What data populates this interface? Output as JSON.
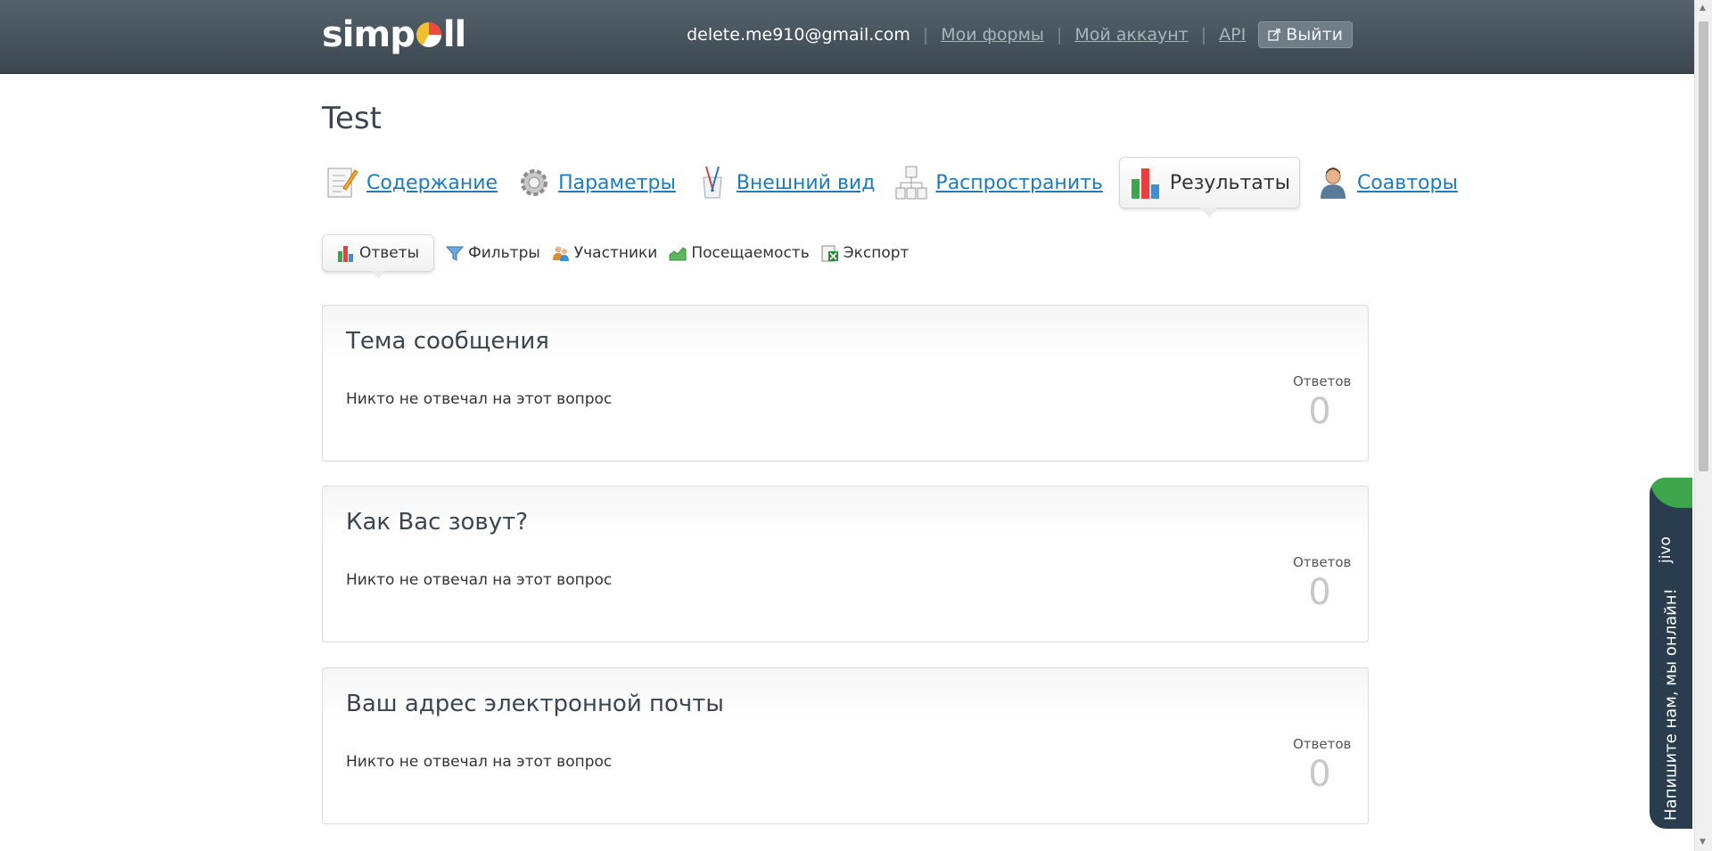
{
  "header": {
    "logo": "simpoll",
    "email": "delete.me910@gmail.com",
    "nav": [
      "Мои формы",
      "Мой аккаунт",
      "API"
    ],
    "separator": "|",
    "logout_label": "Выйти"
  },
  "page": {
    "title": "Test"
  },
  "main_tabs": [
    {
      "label": "Содержание",
      "icon": "edit-form-icon",
      "active": false
    },
    {
      "label": "Параметры",
      "icon": "gear-icon",
      "active": false
    },
    {
      "label": "Внешний вид",
      "icon": "paint-brushes-icon",
      "active": false
    },
    {
      "label": "Распространить",
      "icon": "share-tree-icon",
      "active": false
    },
    {
      "label": "Результаты",
      "icon": "bar-chart-icon",
      "active": true
    },
    {
      "label": "Соавторы",
      "icon": "user-icon",
      "active": false
    }
  ],
  "sub_tabs": [
    {
      "label": "Ответы",
      "icon": "bar-chart-icon",
      "active": true
    },
    {
      "label": "Фильтры",
      "icon": "funnel-icon",
      "active": false
    },
    {
      "label": "Участники",
      "icon": "users-icon",
      "active": false
    },
    {
      "label": "Посещаемость",
      "icon": "line-chart-icon",
      "active": false
    },
    {
      "label": "Экспорт",
      "icon": "excel-export-icon",
      "active": false
    }
  ],
  "questions": [
    {
      "title": "Тема сообщения",
      "empty_text": "Никто не отвечал на этот вопрос",
      "count_label": "Ответов",
      "count": "0"
    },
    {
      "title": "Как Вас зовут?",
      "empty_text": "Никто не отвечал на этот вопрос",
      "count_label": "Ответов",
      "count": "0"
    },
    {
      "title": "Ваш адрес электронной почты",
      "empty_text": "Никто не отвечал на этот вопрос",
      "count_label": "Ответов",
      "count": "0"
    }
  ],
  "chat_widget": {
    "brand": "jivo",
    "message": "Напишите нам, мы онлайн!"
  },
  "colors": {
    "header_bg": "#46535d",
    "link": "#1e7bbd",
    "chat_bg": "#2a3d4e",
    "chat_accent": "#3fa64b"
  }
}
